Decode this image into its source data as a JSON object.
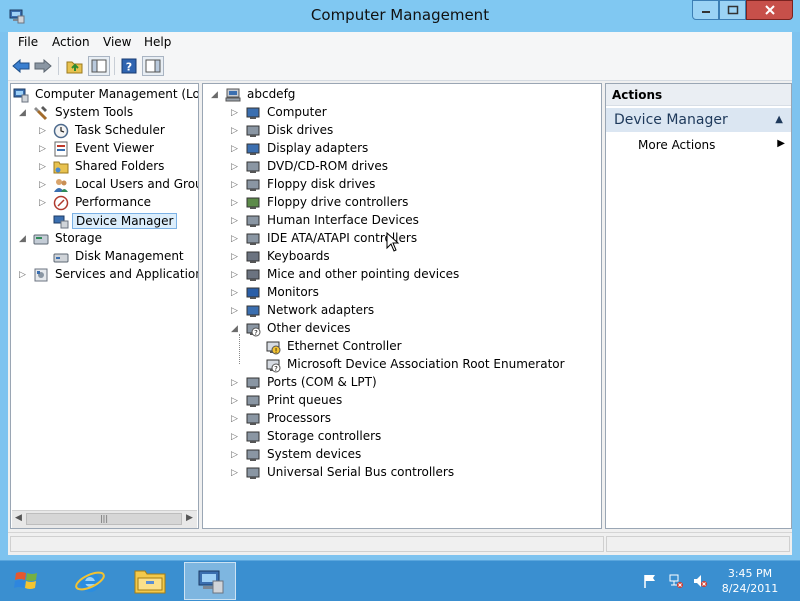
{
  "window": {
    "title": "Computer Management",
    "controls": {
      "minimize_icon": "minimize-icon",
      "maximize_icon": "maximize-icon",
      "close_icon": "close-icon"
    },
    "colors": {
      "title_bar": "#80c8f2",
      "close": "#c7504a"
    }
  },
  "menu": {
    "items": [
      "File",
      "Action",
      "View",
      "Help"
    ]
  },
  "toolbar": {
    "buttons": [
      "back-arrow-icon",
      "forward-arrow-icon",
      "up-folder-icon",
      "show-hide-console-tree-icon",
      "help-icon",
      "show-hide-action-pane-icon"
    ]
  },
  "left_tree": {
    "root": "Computer Management (Local",
    "system_tools": "System Tools",
    "task_scheduler": "Task Scheduler",
    "event_viewer": "Event Viewer",
    "shared_folders": "Shared Folders",
    "local_users": "Local Users and Groups",
    "performance": "Performance",
    "device_manager": "Device Manager",
    "storage": "Storage",
    "disk_management": "Disk Management",
    "services": "Services and Applications"
  },
  "device_tree": {
    "root": "abcdefg",
    "categories": [
      "Computer",
      "Disk drives",
      "Display adapters",
      "DVD/CD-ROM drives",
      "Floppy disk drives",
      "Floppy drive controllers",
      "Human Interface Devices",
      "IDE ATA/ATAPI controllers",
      "Keyboards",
      "Mice and other pointing devices",
      "Monitors",
      "Network adapters",
      "Other devices"
    ],
    "other_devices": [
      "Ethernet Controller",
      "Microsoft Device Association Root Enumerator"
    ],
    "categories_after": [
      "Ports (COM & LPT)",
      "Print queues",
      "Processors",
      "Storage controllers",
      "System devices",
      "Universal Serial Bus controllers"
    ]
  },
  "actions": {
    "header": "Actions",
    "section": "Device Manager",
    "more_actions": "More Actions"
  },
  "taskbar": {
    "apps": [
      "start-icon",
      "internet-explorer-icon",
      "file-explorer-icon",
      "computer-management-icon"
    ],
    "tray": [
      "action-center-flag-icon",
      "network-icon",
      "volume-muted-icon"
    ],
    "time": "3:45 PM",
    "date": "8/24/2011"
  }
}
